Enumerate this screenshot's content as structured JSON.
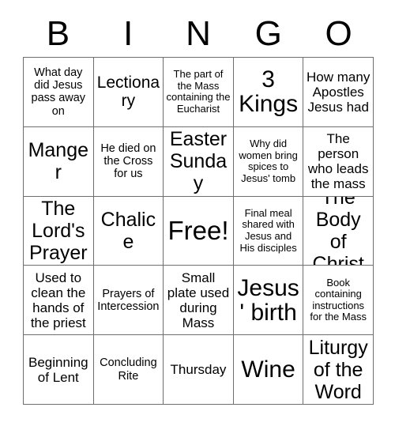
{
  "card": {
    "title": "Bingo Card",
    "header_letters": [
      "B",
      "I",
      "N",
      "G",
      "O"
    ],
    "columns": 5,
    "rows": 5,
    "grid_line_color": "#6e6e6e",
    "text_color": "#000000",
    "background_color": "#ffffff",
    "free_space": {
      "row": 3,
      "column": 3,
      "label": "Free!"
    },
    "cells": [
      [
        {
          "text": "What day did Jesus pass away on",
          "size": "s"
        },
        {
          "text": "Lectionary",
          "size": "l"
        },
        {
          "text": "The part of the Mass containing the Eucharist",
          "size": "xs"
        },
        {
          "text": "3 Kings",
          "size": "xxl"
        },
        {
          "text": "How many Apostles Jesus had",
          "size": "m"
        }
      ],
      [
        {
          "text": "Manger",
          "size": "xl"
        },
        {
          "text": "He died on the Cross for us",
          "size": "s"
        },
        {
          "text": "Easter Sunday",
          "size": "xl"
        },
        {
          "text": "Why did women bring spices to Jesus' tomb",
          "size": "xs"
        },
        {
          "text": "The person who leads the mass",
          "size": "m"
        }
      ],
      [
        {
          "text": "The Lord's Prayer",
          "size": "xl"
        },
        {
          "text": "Chalice",
          "size": "xl"
        },
        {
          "text": "Free!",
          "size": "free"
        },
        {
          "text": "Final meal shared with Jesus and His disciples",
          "size": "xs"
        },
        {
          "text": "The Body of Christ",
          "size": "xl"
        }
      ],
      [
        {
          "text": "Used to clean the hands of the priest",
          "size": "m"
        },
        {
          "text": "Prayers of Intercession",
          "size": "s"
        },
        {
          "text": "Small plate used during Mass",
          "size": "m"
        },
        {
          "text": "Jesus' birth",
          "size": "xxl"
        },
        {
          "text": "Book containing instructions for the Mass",
          "size": "xs"
        }
      ],
      [
        {
          "text": "Beginning of Lent",
          "size": "m"
        },
        {
          "text": "Concluding Rite",
          "size": "s"
        },
        {
          "text": "Thursday",
          "size": "m"
        },
        {
          "text": "Wine",
          "size": "xxl"
        },
        {
          "text": "Liturgy of the Word",
          "size": "xl"
        }
      ]
    ]
  }
}
